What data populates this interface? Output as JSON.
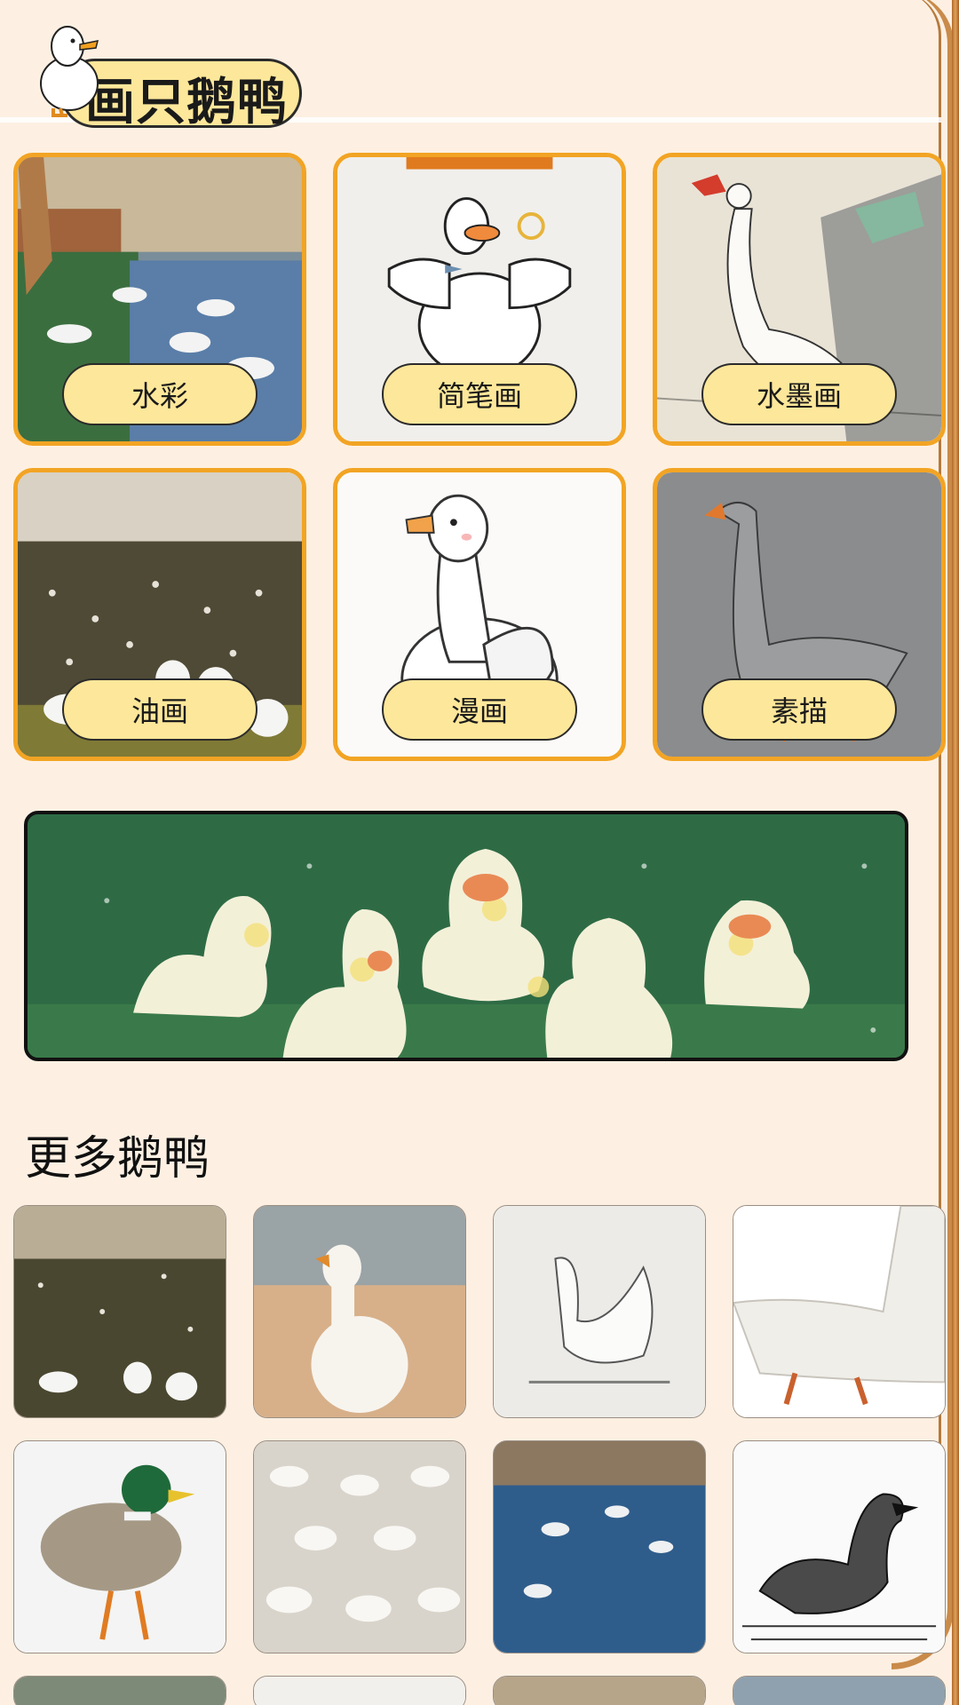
{
  "header": {
    "title": "画只鹅鸭"
  },
  "styles": [
    {
      "label": "水彩",
      "icon": "watercolor-swans-image"
    },
    {
      "label": "简笔画",
      "icon": "line-drawing-goose-image"
    },
    {
      "label": "水墨画",
      "icon": "ink-painting-goose-image"
    },
    {
      "label": "油画",
      "icon": "oil-painting-geese-image"
    },
    {
      "label": "漫画",
      "icon": "cartoon-goose-image"
    },
    {
      "label": "素描",
      "icon": "pencil-sketch-goose-image"
    }
  ],
  "banner": {
    "icon": "sparkler-ducks-banner"
  },
  "more": {
    "title": "更多鹅鸭",
    "items": [
      {
        "icon": "geese-in-flowers-thumbnail"
      },
      {
        "icon": "goose-in-field-thumbnail"
      },
      {
        "icon": "sketch-swan-thumbnail"
      },
      {
        "icon": "white-goose-closeup-thumbnail"
      },
      {
        "icon": "mallard-duck-thumbnail"
      },
      {
        "icon": "goose-flock-thumbnail"
      },
      {
        "icon": "swans-on-lake-thumbnail"
      },
      {
        "icon": "lineart-goose-thumbnail"
      }
    ]
  },
  "colors": {
    "background": "#fdf0e2",
    "accent_border": "#f2a424",
    "pill_fill": "#fde79a"
  }
}
